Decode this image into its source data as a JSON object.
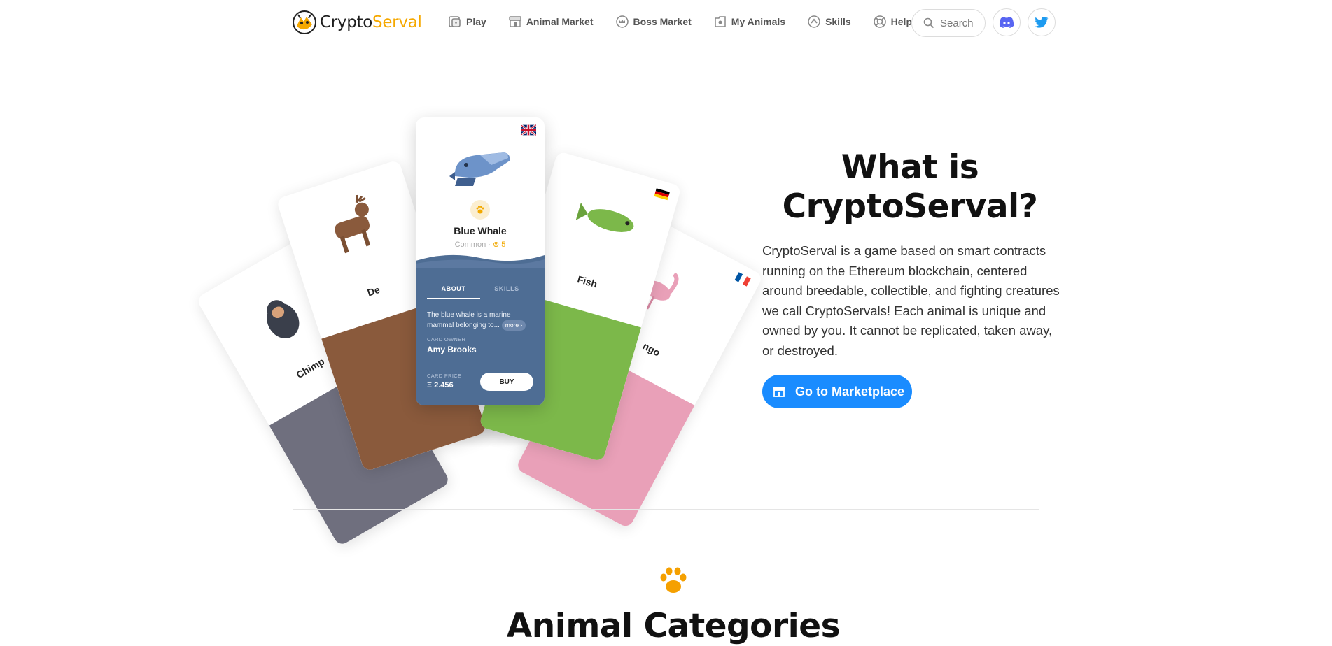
{
  "brand": {
    "name_part1": "Crypto",
    "name_part2": "Serval",
    "accent_color": "#f5a800"
  },
  "nav": {
    "items": [
      {
        "label": "Play",
        "icon": "dice-icon"
      },
      {
        "label": "Animal Market",
        "icon": "store-icon"
      },
      {
        "label": "Boss Market",
        "icon": "crown-badge-icon"
      },
      {
        "label": "My Animals",
        "icon": "folder-animal-icon"
      },
      {
        "label": "Skills",
        "icon": "skill-badge-icon"
      },
      {
        "label": "Help",
        "icon": "lifebuoy-icon"
      }
    ],
    "search_label": "Search",
    "discord_icon": "discord-icon",
    "twitter_icon": "twitter-icon"
  },
  "hero": {
    "title": "What is CryptoServal?",
    "text": "CryptoServal is a game based on smart contracts running on the Ethereum blockchain, centered around breedable, collectible, and fighting creatures we call CryptoServals! Each animal is unique and owned by you. It cannot be replicated, taken away, or destroyed.",
    "cta_label": "Go to Marketplace",
    "cta_color": "#1a8cff"
  },
  "featured_card": {
    "name": "Blue Whale",
    "rarity": "Common",
    "coin_value": "5",
    "tab_about": "ABOUT",
    "tab_skills": "SKILLS",
    "description": "The blue whale is a marine mammal belonging to...",
    "more_label": "more",
    "owner_label": "CARD OWNER",
    "owner": "Amy Brooks",
    "price_label": "CARD PRICE",
    "price": "Ξ 2.456",
    "buy_label": "BUY",
    "card_color": "#4e6d94"
  },
  "side_cards": [
    {
      "name_visible": "Chimp",
      "color": "#6f6f7e"
    },
    {
      "name_visible": "De",
      "color": "#8a5a3c"
    },
    {
      "name_visible": "Fish",
      "color": "#7cb84a"
    },
    {
      "name_visible": "ngo",
      "color": "#e9a0b8"
    }
  ],
  "categories": {
    "title": "Animal Categories"
  }
}
